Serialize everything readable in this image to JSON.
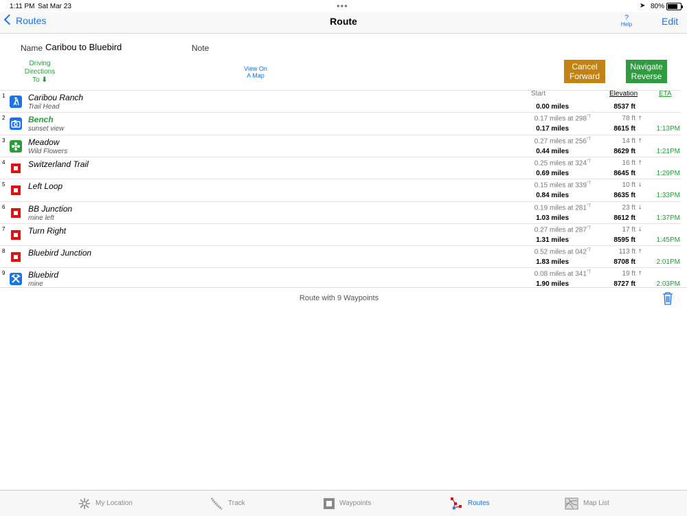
{
  "status": {
    "time": "1:11 PM",
    "date": "Sat Mar 23",
    "battery": "80%"
  },
  "nav": {
    "back_label": "Routes",
    "title": "Route",
    "help_label": "Help",
    "help_mark": "?",
    "edit_label": "Edit"
  },
  "header": {
    "name_label": "Name",
    "name_value": "Caribou to Bluebird",
    "note_label": "Note",
    "driving_line1": "Driving",
    "driving_line2": "Directions",
    "driving_line3": "To",
    "view_map_line1": "View On",
    "view_map_line2": "A Map",
    "cancel_line1": "Cancel",
    "cancel_line2": "Forward",
    "reverse_line1": "Navigate",
    "reverse_line2": "Reverse"
  },
  "columns": {
    "start": "Start",
    "elevation": "Elevation",
    "eta": "ETA"
  },
  "waypoints": [
    {
      "num": "1",
      "icon": "hiker-icon",
      "icon_color": "#1a73e8",
      "name": "Caribou Ranch",
      "sub": "Trail Head",
      "leg": "",
      "leg_unit": "",
      "cum": "0.00 miles",
      "delta": "",
      "arrow": "",
      "elev": "8537 ft",
      "eta": ""
    },
    {
      "num": "2",
      "icon": "camera-icon",
      "icon_color": "#1a73e8",
      "name": "Bench",
      "sub": "sunset view",
      "leg": "0.17 miles at 298",
      "leg_unit": "°T",
      "cum": "0.17 miles",
      "delta": "78 ft",
      "arrow": "↑",
      "elev": "8615 ft",
      "eta": "1:13PM",
      "highlight": true
    },
    {
      "num": "3",
      "icon": "flower-icon",
      "icon_color": "#2a9d3a",
      "name": "Meadow",
      "sub": "Wild Flowers",
      "leg": "0.27 miles at 256",
      "leg_unit": "°T",
      "cum": "0.44 miles",
      "delta": "14 ft",
      "arrow": "↑",
      "elev": "8629 ft",
      "eta": "1:21PM"
    },
    {
      "num": "4",
      "icon": "square-marker-icon",
      "icon_color": "#d11",
      "name": "Switzerland Trail",
      "sub": "",
      "leg": "0.25 miles at 324",
      "leg_unit": "°T",
      "cum": "0.69 miles",
      "delta": "16 ft",
      "arrow": "↑",
      "elev": "8645 ft",
      "eta": "1:29PM"
    },
    {
      "num": "5",
      "icon": "square-marker-icon",
      "icon_color": "#d11",
      "name": "Left Loop",
      "sub": "",
      "leg": "0.15 miles at 339",
      "leg_unit": "°T",
      "cum": "0.84 miles",
      "delta": "10 ft",
      "arrow": "↓",
      "elev": "8635 ft",
      "eta": "1:33PM"
    },
    {
      "num": "6",
      "icon": "square-marker-icon",
      "icon_color": "#d11",
      "name": "BB Junction",
      "sub": "mine left",
      "leg": "0.19 miles at 281",
      "leg_unit": "°T",
      "cum": "1.03 miles",
      "delta": "23 ft",
      "arrow": "↓",
      "elev": "8612 ft",
      "eta": "1:37PM"
    },
    {
      "num": "7",
      "icon": "square-marker-icon",
      "icon_color": "#d11",
      "name": "Turn Right",
      "sub": "",
      "leg": "0.27 miles at 287",
      "leg_unit": "°T",
      "cum": "1.31 miles",
      "delta": "17 ft",
      "arrow": "↓",
      "elev": "8595 ft",
      "eta": "1:45PM"
    },
    {
      "num": "8",
      "icon": "square-marker-icon",
      "icon_color": "#d11",
      "name": "Bluebird Junction",
      "sub": "",
      "leg": "0.52 miles at 042",
      "leg_unit": "°T",
      "cum": "1.83 miles",
      "delta": "113 ft",
      "arrow": "↑",
      "elev": "8708 ft",
      "eta": "2:01PM"
    },
    {
      "num": "9",
      "icon": "mine-icon",
      "icon_color": "#1a73e8",
      "name": "Bluebird",
      "sub": "mine",
      "leg": "0.08 miles at 341",
      "leg_unit": "°T",
      "cum": "1.90 miles",
      "delta": "19 ft",
      "arrow": "↑",
      "elev": "8727 ft",
      "eta": "2:03PM"
    }
  ],
  "footer": {
    "summary": "Route with 9 Waypoints"
  },
  "tabs": [
    {
      "label": "My Location",
      "icon": "location-icon",
      "active": false
    },
    {
      "label": "Track",
      "icon": "track-icon",
      "active": false
    },
    {
      "label": "Waypoints",
      "icon": "waypoints-icon",
      "active": false
    },
    {
      "label": "Routes",
      "icon": "routes-icon",
      "active": true
    },
    {
      "label": "Map List",
      "icon": "map-list-icon",
      "active": false
    }
  ],
  "colors": {
    "accent": "#1a73e8",
    "green": "#2a9d3a",
    "cancel": "#c28312",
    "reverse": "#2f9d3f",
    "marker_red": "#dd1111"
  }
}
